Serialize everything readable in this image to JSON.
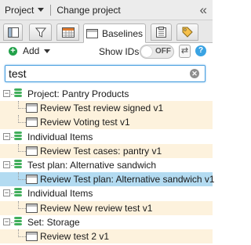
{
  "topbar": {
    "project_label": "Project",
    "change_project_label": "Change project",
    "collapse_glyph": "«"
  },
  "tabs": [
    {
      "icon": "list-view-icon"
    },
    {
      "icon": "filter-icon"
    },
    {
      "icon": "calendar-icon"
    },
    {
      "icon": "baselines-icon",
      "label": "Baselines",
      "active": true
    },
    {
      "icon": "clipboard-icon"
    },
    {
      "icon": "tag-icon"
    }
  ],
  "toolbar": {
    "add_label": "Add",
    "show_ids_label": "Show IDs",
    "toggle_state": "OFF"
  },
  "search": {
    "value": "test"
  },
  "tree": [
    {
      "type": "folder",
      "label": "Project: Pantry Products"
    },
    {
      "type": "item",
      "label": "Review Test review signed v1"
    },
    {
      "type": "item",
      "label": "Review Voting test v1"
    },
    {
      "type": "folder",
      "label": "Individual Items"
    },
    {
      "type": "item",
      "label": "Review Test cases: pantry v1"
    },
    {
      "type": "folder",
      "label": "Test plan: Alternative sandwich"
    },
    {
      "type": "item",
      "label": "Review Test plan: Alternative sandwich v1",
      "selected": true
    },
    {
      "type": "folder",
      "label": "Individual Items"
    },
    {
      "type": "item",
      "label": "Review New review test v1"
    },
    {
      "type": "folder",
      "label": "Set: Storage"
    },
    {
      "type": "item",
      "label": "Review test 2 v1"
    }
  ],
  "colors": {
    "folder_icon": "#3fae5a",
    "item_row": "#fdf2dd",
    "selected_row": "#b3dbf1",
    "accent": "#3aa3e3"
  }
}
